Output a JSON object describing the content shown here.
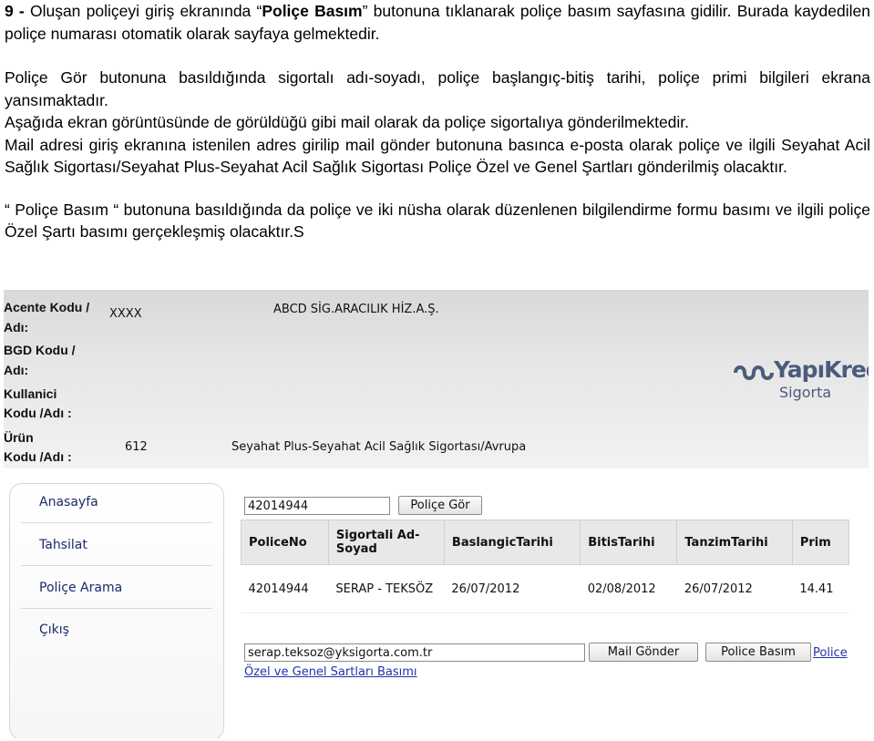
{
  "document": {
    "p1_num": "9 - ",
    "p1_a": "Oluşan poliçeyi giriş ekranında “",
    "p1_b": "Poliçe Basım",
    "p1_c": "” butonuna tıklanarak poliçe basım sayfasına gidilir. Burada kaydedilen poliçe numarası otomatik olarak sayfaya gelmektedir.",
    "p2": "Poliçe Gör butonuna basıldığında sigortalı adı-soyadı, poliçe başlangıç-bitiş tarihi, poliçe primi bilgileri ekrana yansımaktadır.",
    "p3": "Aşağıda ekran görüntüsünde de görüldüğü gibi mail olarak da poliçe sigortalıya gönderilmektedir.",
    "p4": "Mail adresi giriş ekranına istenilen adres girilip mail gönder butonuna basınca e-posta olarak poliçe ve ilgili Seyahat Acil Sağlık Sigortası/Seyahat Plus-Seyahat Acil Sağlık Sigortası Poliçe Özel ve Genel Şartları gönderilmiş olacaktır.",
    "p5": "“ Poliçe Basım “ butonuna basıldığında da poliçe ve iki nüsha olarak düzenlenen bilgilendirme formu basımı ve ilgili poliçe Özel Şartı basımı gerçekleşmiş olacaktır.S"
  },
  "screenshot": {
    "header": {
      "acente_label": "Acente Kodu /",
      "adi_label_1": "Adı:",
      "acente_code": "XXXX",
      "acente_name": "ABCD SİG.ARACILIK HİZ.A.Ş.",
      "bgd_label": "BGD Kodu /",
      "adi_label_2": "Adı:",
      "kullanici_label": "Kullanici",
      "kullanici_label_2": "Kodu /Adı :",
      "urun_label": "Ürün",
      "urun_label_2": "Kodu /Adı :",
      "urun_code": "612",
      "urun_name": "Seyahat Plus-Seyahat Acil Sağlık Sigortası/Avrupa",
      "logo_line1": "YapıKredi",
      "logo_line2": "Sigorta"
    },
    "menu": [
      "Anasayfa",
      "Tahsilat",
      "Poliçe Arama",
      "Çıkış"
    ],
    "search": {
      "policy_no": "42014944",
      "button": "Poliçe Gör"
    },
    "table": {
      "headers": [
        "PoliceNo",
        "Sigortali Ad-Soyad",
        "BaslangicTarihi",
        "BitisTarihi",
        "TanzimTarihi",
        "Prim"
      ],
      "row": [
        "42014944",
        "SERAP - TEKSÖZ",
        "26/07/2012",
        "02/08/2012",
        "26/07/2012",
        "14.41"
      ]
    },
    "mail": {
      "email": "serap.teksoz@yksigorta.com.tr",
      "send_button": "Mail Gönder",
      "print_button": "Police Basım",
      "police_link": "Police",
      "conditions_link": "Özel ve Genel Sartları Basımı"
    }
  }
}
